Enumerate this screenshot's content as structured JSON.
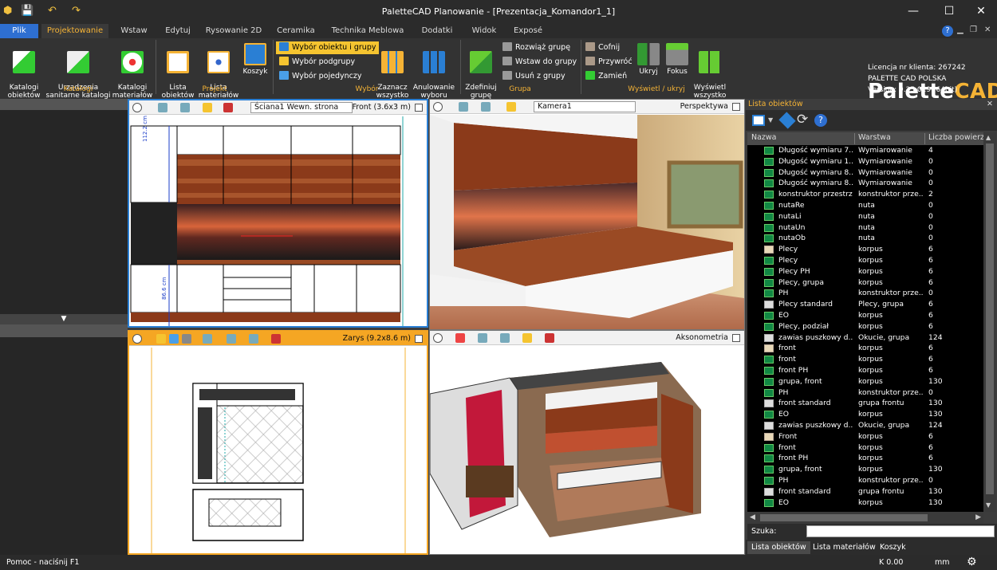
{
  "app": {
    "title": "PaletteCAD Planowanie - [Prezentacja_Komandor1_1]"
  },
  "window_controls": {
    "minimize": "—",
    "maximize": "☐",
    "close": "✕"
  },
  "menu_tabs": [
    {
      "label": "Plik"
    },
    {
      "label": "Projektowanie"
    },
    {
      "label": "Wstaw"
    },
    {
      "label": "Edytuj"
    },
    {
      "label": "Rysowanie 2D"
    },
    {
      "label": "Ceramika"
    },
    {
      "label": "Technika Meblowa"
    },
    {
      "label": "Dodatki"
    },
    {
      "label": "Widok"
    },
    {
      "label": "Exposé"
    }
  ],
  "help_label": "?",
  "ribbon": {
    "katalogi": {
      "group_label": "Katalogi",
      "buttons": [
        {
          "label": "Katalogi\nobiektów"
        },
        {
          "label": "Urządzenia\nsanitarne katalogi"
        },
        {
          "label": "Katalogi\nmateriałów"
        }
      ]
    },
    "projekt": {
      "group_label": "Projekt",
      "buttons": [
        {
          "label": "Lista\nobiektów"
        },
        {
          "label": "Lista\nmateriałów"
        },
        {
          "label": "Koszyk"
        }
      ]
    },
    "wybor": {
      "group_label": "Wybór",
      "small": [
        {
          "label": "Wybór obiektu i grupy"
        },
        {
          "label": "Wybór podgrupy"
        },
        {
          "label": "Wybór pojedynczy"
        }
      ],
      "buttons": [
        {
          "label": "Zaznacz\nwszystko"
        },
        {
          "label": "Anulowanie\nwyboru"
        }
      ]
    },
    "grupa": {
      "group_label": "Grupa",
      "buttons": [
        {
          "label": "Zdefiniuj\ngrupę"
        }
      ],
      "small": [
        {
          "label": "Rozwiąż grupę"
        },
        {
          "label": "Wstaw do grupy"
        },
        {
          "label": "Usuń z grupy"
        }
      ]
    },
    "wyswietl": {
      "group_label": "Wyświetl / ukryj",
      "small": [
        {
          "label": "Cofnij"
        },
        {
          "label": "Przywróć"
        },
        {
          "label": "Zamień"
        }
      ],
      "buttons": [
        {
          "label": "Ukryj"
        },
        {
          "label": "Fokus"
        },
        {
          "label": "Wyświetl\nwszystko"
        }
      ]
    }
  },
  "brand": {
    "logo_a": "Palette",
    "logo_b": "CAD",
    "license": "Licencja nr klienta: 267242",
    "company": "PALETTE CAD POLSKA",
    "version": "Version: 9.25.029 (64bit)"
  },
  "viewports": {
    "front": {
      "wall_select": "Ściana1 Wewn. strona",
      "label": "Front  (3.6x3 m)",
      "dim_top": "112.2 cm",
      "dim_bottom": "86.6 cm"
    },
    "perspective": {
      "camera_select": "Kamera1",
      "label": "Perspektywa"
    },
    "plan": {
      "label": "Zarys  (9.2x8.6 m)"
    },
    "axonometric": {
      "label": "Aksonometria"
    }
  },
  "right_panel": {
    "title": "Lista obiektów",
    "columns": [
      "Nazwa",
      "Warstwa",
      "Liczba powierzc"
    ],
    "rows": [
      {
        "icon": "green",
        "name": "Długość wymiaru 7...",
        "layer": "Wymiarowanie",
        "count": "4"
      },
      {
        "icon": "green",
        "name": "Długość wymiaru 1...",
        "layer": "Wymiarowanie",
        "count": "0"
      },
      {
        "icon": "green",
        "name": "Długość wymiaru 8...",
        "layer": "Wymiarowanie",
        "count": "0"
      },
      {
        "icon": "green",
        "name": "Długość wymiaru 8...",
        "layer": "Wymiarowanie",
        "count": "0"
      },
      {
        "icon": "green",
        "name": "konstruktor przestrz",
        "layer": "konstruktor prze...",
        "count": "2"
      },
      {
        "icon": "green",
        "name": "nutaRe",
        "layer": "nuta",
        "count": "0"
      },
      {
        "icon": "green",
        "name": "nutaLi",
        "layer": "nuta",
        "count": "0"
      },
      {
        "icon": "green",
        "name": "nutaUn",
        "layer": "nuta",
        "count": "0"
      },
      {
        "icon": "green",
        "name": "nutaOb",
        "layer": "nuta",
        "count": "0"
      },
      {
        "icon": "beige",
        "name": "Plecy",
        "layer": "korpus",
        "count": "6"
      },
      {
        "icon": "green",
        "name": "Plecy",
        "layer": "korpus",
        "count": "6"
      },
      {
        "icon": "green",
        "name": "Plecy PH",
        "layer": "korpus",
        "count": "6"
      },
      {
        "icon": "green",
        "name": "Plecy, grupa",
        "layer": "korpus",
        "count": "6"
      },
      {
        "icon": "green",
        "name": "PH",
        "layer": "konstruktor prze...",
        "count": "0"
      },
      {
        "icon": "white",
        "name": "Plecy standard",
        "layer": "Plecy, grupa",
        "count": "6"
      },
      {
        "icon": "green",
        "name": "EO",
        "layer": "korpus",
        "count": "6"
      },
      {
        "icon": "green",
        "name": "Plecy, podział",
        "layer": "korpus",
        "count": "6"
      },
      {
        "icon": "white",
        "name": "zawias puszkowy d...",
        "layer": "Okucie, grupa",
        "count": "124"
      },
      {
        "icon": "beige",
        "name": "front",
        "layer": "korpus",
        "count": "6"
      },
      {
        "icon": "green",
        "name": "front",
        "layer": "korpus",
        "count": "6"
      },
      {
        "icon": "green",
        "name": "front PH",
        "layer": "korpus",
        "count": "6"
      },
      {
        "icon": "green",
        "name": "grupa, front",
        "layer": "korpus",
        "count": "130"
      },
      {
        "icon": "green",
        "name": "PH",
        "layer": "konstruktor prze...",
        "count": "0"
      },
      {
        "icon": "white",
        "name": "front standard",
        "layer": "grupa frontu",
        "count": "130"
      },
      {
        "icon": "green",
        "name": "EO",
        "layer": "korpus",
        "count": "130"
      },
      {
        "icon": "white",
        "name": "zawias puszkowy d...",
        "layer": "Okucie, grupa",
        "count": "124"
      },
      {
        "icon": "beige",
        "name": "Front",
        "layer": "korpus",
        "count": "6"
      },
      {
        "icon": "green",
        "name": "front",
        "layer": "korpus",
        "count": "6"
      },
      {
        "icon": "green",
        "name": "front PH",
        "layer": "korpus",
        "count": "6"
      },
      {
        "icon": "green",
        "name": "grupa, front",
        "layer": "korpus",
        "count": "130"
      },
      {
        "icon": "green",
        "name": "PH",
        "layer": "konstruktor prze...",
        "count": "0"
      },
      {
        "icon": "white",
        "name": "front standard",
        "layer": "grupa frontu",
        "count": "130"
      },
      {
        "icon": "green",
        "name": "EO",
        "layer": "korpus",
        "count": "130"
      }
    ],
    "search_label": "Szuka:",
    "search_value": "",
    "tabs": [
      "Lista obiektów",
      "Lista materiałów",
      "Koszyk"
    ]
  },
  "status": {
    "help": "Pomoc - naciśnij F1",
    "k": "K 0.00",
    "unit": "mm"
  },
  "colors": {
    "accent": "#f5b335",
    "plik": "#2e6fd1",
    "select_hl": "#f5c430"
  }
}
